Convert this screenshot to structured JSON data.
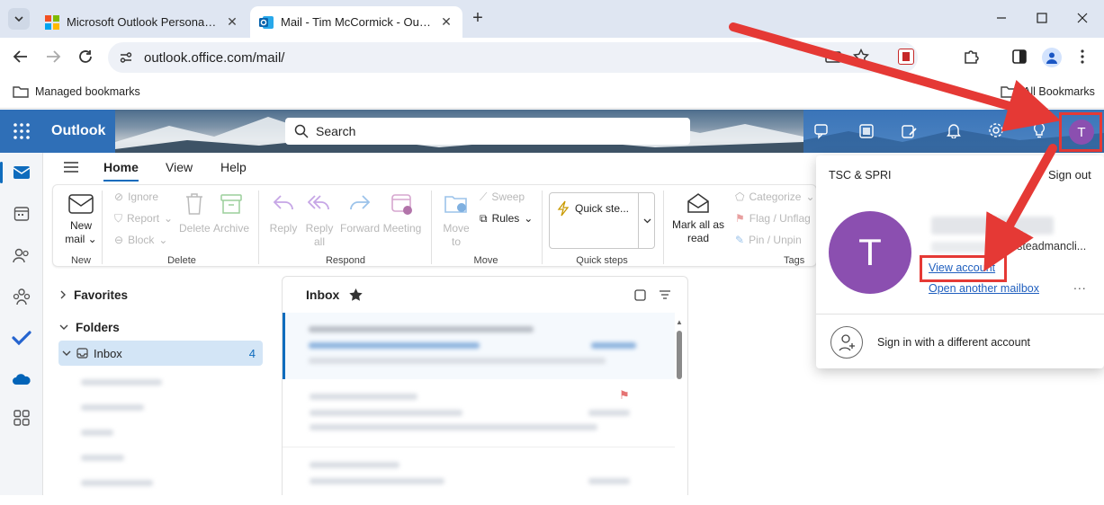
{
  "browser": {
    "tabs": [
      {
        "title": "Microsoft Outlook Personal Ema",
        "active": false
      },
      {
        "title": "Mail - Tim McCormick - Outlook",
        "active": true
      }
    ],
    "new_tab_symbol": "+",
    "url": "outlook.office.com/mail/",
    "bookmarks_left": "Managed bookmarks",
    "bookmarks_right": "All Bookmarks"
  },
  "app": {
    "name": "Outlook",
    "search_placeholder": "Search",
    "avatar_initial": "T",
    "menu_tabs": [
      "Home",
      "View",
      "Help"
    ],
    "active_menu_tab": "Home"
  },
  "ribbon": {
    "new_mail": {
      "line1": "New",
      "line2": "mail"
    },
    "delete_group": {
      "ignore": "Ignore",
      "report": "Report",
      "block": "Block",
      "delete": "Delete",
      "archive": "Archive",
      "label": "Delete"
    },
    "new_group_label": "New",
    "respond_group": {
      "reply": "Reply",
      "reply_all_1": "Reply",
      "reply_all_2": "all",
      "forward": "Forward",
      "meeting": "Meeting",
      "label": "Respond"
    },
    "move_group": {
      "move_to_1": "Move",
      "move_to_2": "to",
      "sweep": "Sweep",
      "rules": "Rules",
      "label": "Move"
    },
    "quick_steps": {
      "button": "Quick ste...",
      "label": "Quick steps"
    },
    "tags_group": {
      "mark_all_1": "Mark all as",
      "mark_all_2": "read",
      "categorize": "Categorize",
      "flag": "Flag / Unflag",
      "pin": "Pin / Unpin",
      "label": "Tags"
    }
  },
  "folders": {
    "favorites": "Favorites",
    "folders": "Folders",
    "inbox": "Inbox",
    "inbox_count": "4"
  },
  "maillist": {
    "title": "Inbox"
  },
  "account_popup": {
    "org": "TSC & SPRI",
    "sign_out": "Sign out",
    "initial": "T",
    "email_fragment": "@thesteadmancli...",
    "view_account": "View account",
    "open_another": "Open another mailbox",
    "more": "...",
    "sign_in_different": "Sign in with a different account"
  },
  "colors": {
    "outlook_blue": "#2f6fb7",
    "avatar_purple": "#8b4fb0",
    "annotation_red": "#e53935",
    "link_blue": "#1f5fbf"
  }
}
